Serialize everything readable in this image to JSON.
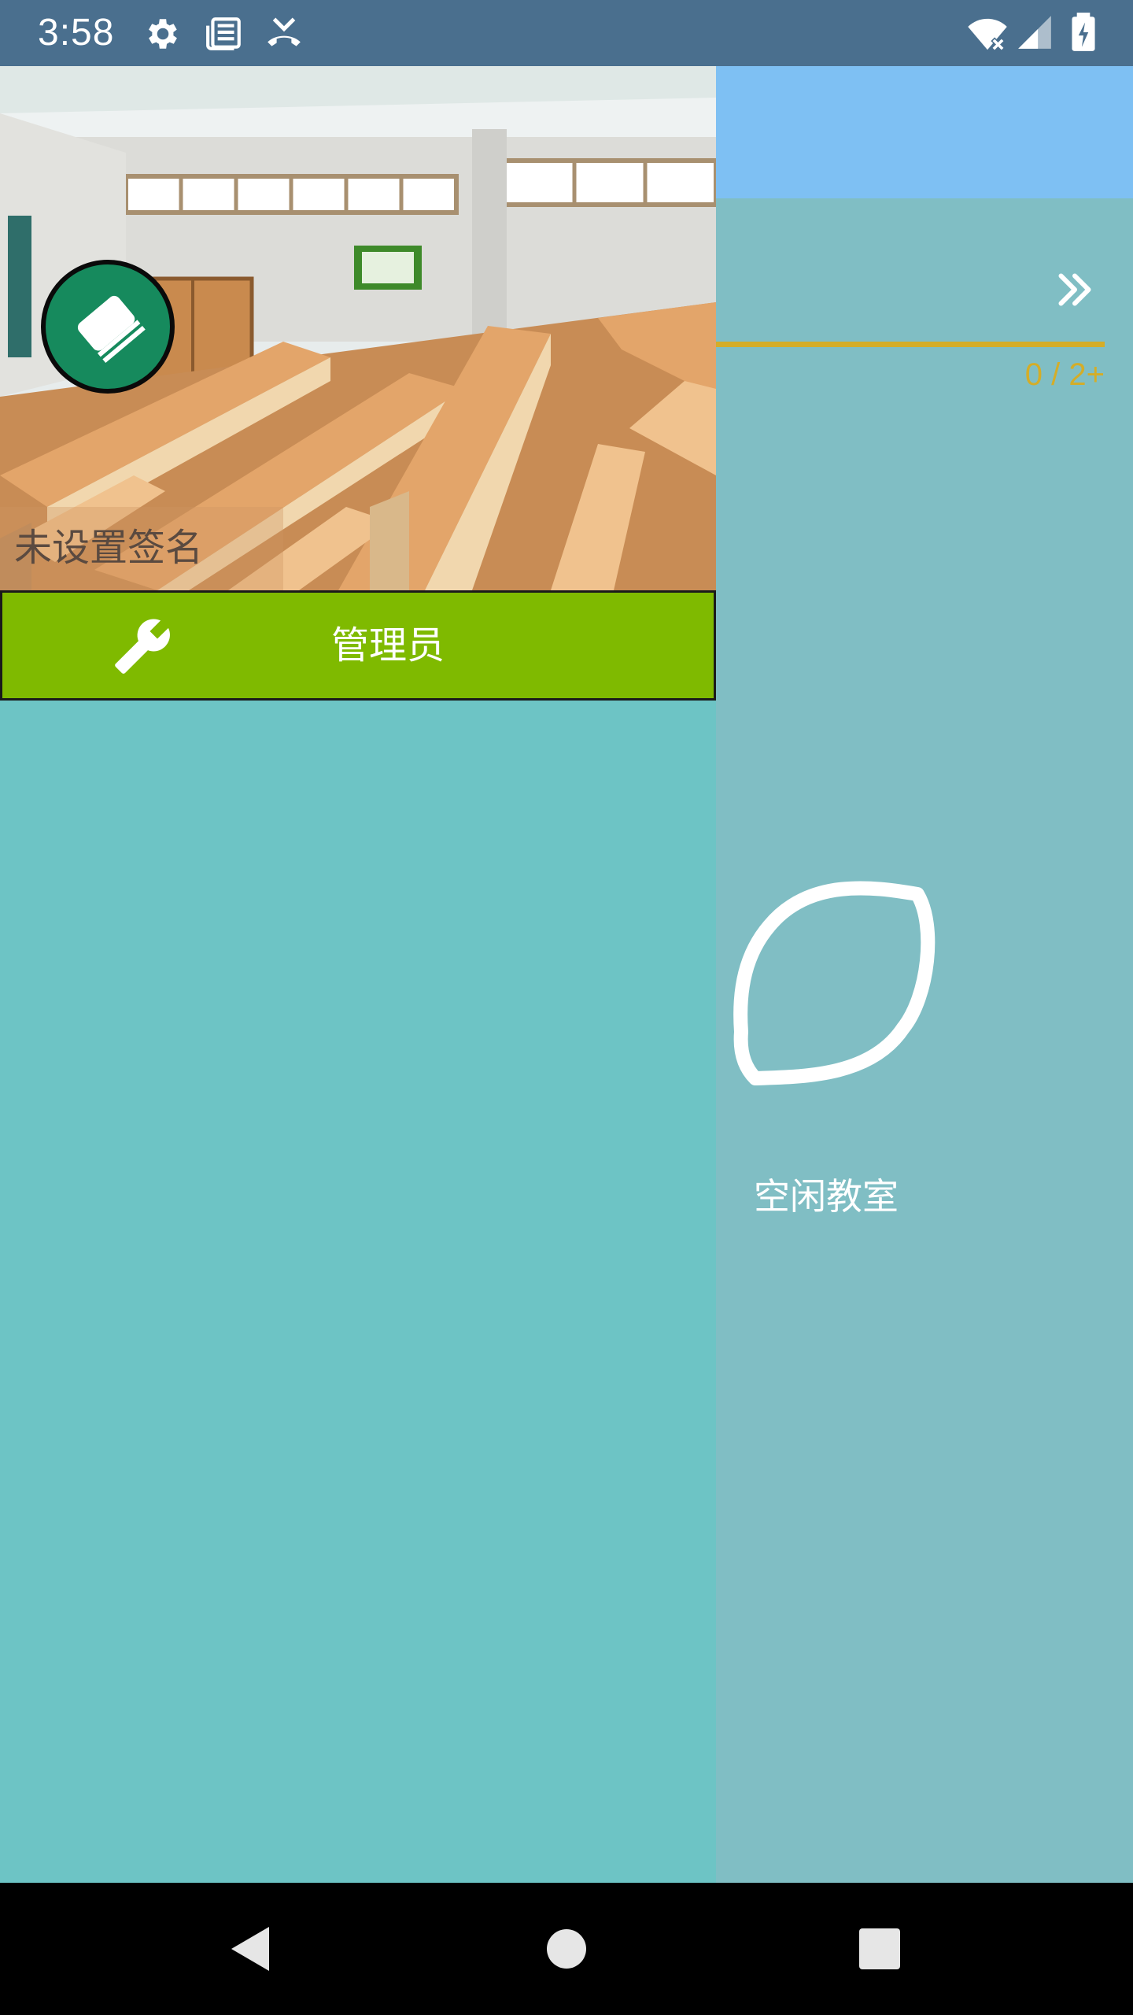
{
  "status_bar": {
    "time": "3:58",
    "left_icons": [
      "gear-icon",
      "news-icon",
      "missed-call-icon"
    ],
    "right_icons": [
      "wifi-off-icon",
      "signal-icon",
      "battery-charging-icon"
    ],
    "background": "#4a6f8e"
  },
  "drawer": {
    "signature": "未设置签名",
    "admin_button": {
      "label": "管理员",
      "icon": "wrench-icon",
      "color": "#7fba00"
    },
    "avatar_icon": "eraser-icon",
    "background": "#6dc4c5"
  },
  "main": {
    "topbar_color": "#7ec0f3",
    "next_icon": "double-chevron-right-icon",
    "progress_text": "0 / 2+",
    "progress_color": "#d4ad28",
    "empty_icon": "lemon-icon",
    "empty_label": "空闲教室"
  },
  "nav_bar": {
    "buttons": [
      "back-icon",
      "home-icon",
      "recents-icon"
    ]
  }
}
